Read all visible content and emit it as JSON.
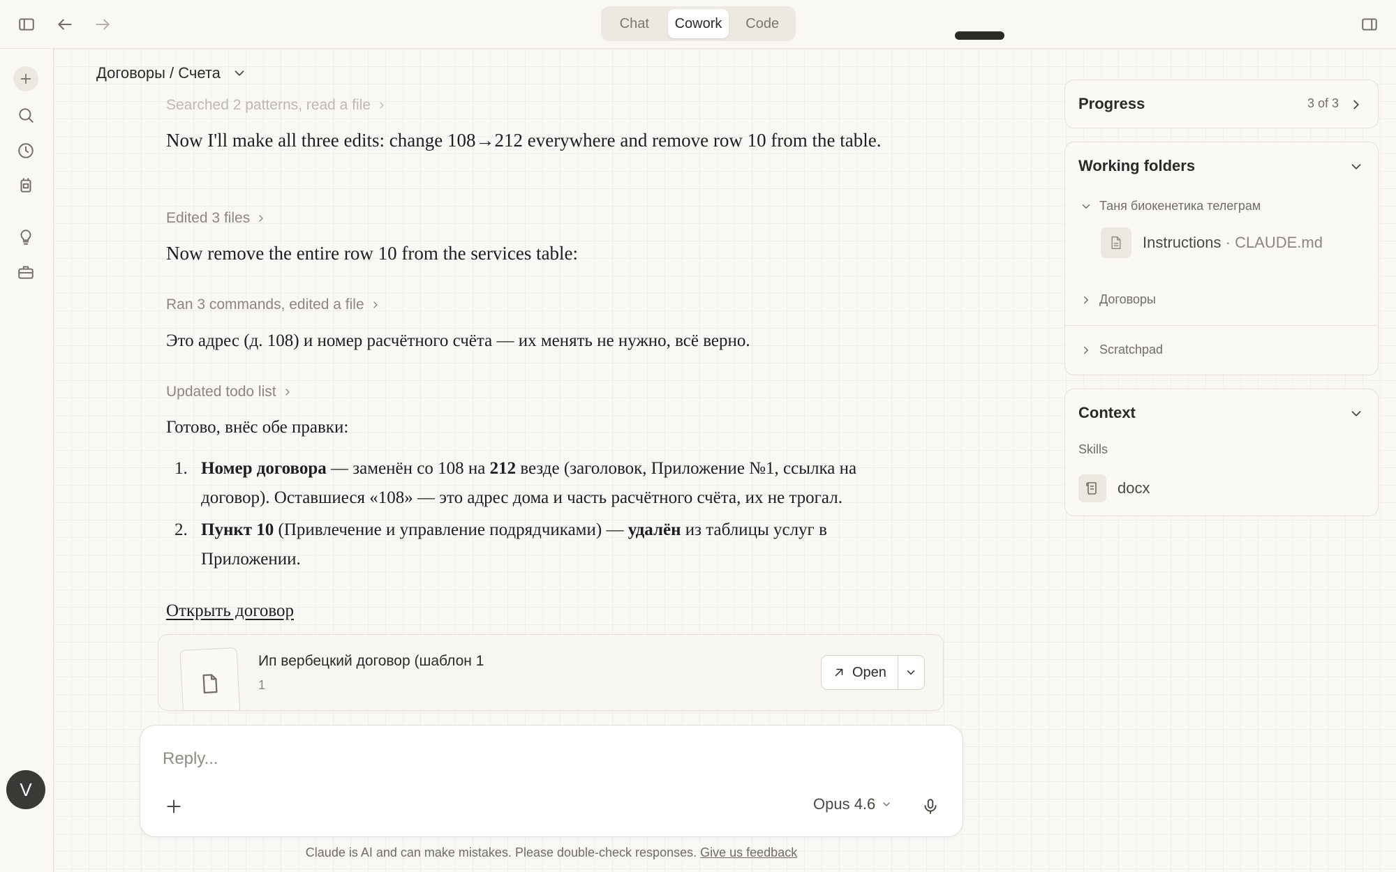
{
  "topbar": {
    "modes": [
      {
        "label": "Chat",
        "active": false
      },
      {
        "label": "Cowork",
        "active": true
      },
      {
        "label": "Code",
        "active": false
      }
    ]
  },
  "rail": {
    "icons": [
      "plus-icon",
      "search-icon",
      "clock-icon",
      "dispatch-icon",
      "lightbulb-icon",
      "toolbox-icon",
      "download-icon"
    ],
    "avatar_initial": "V"
  },
  "header": {
    "breadcrumb": "Договоры / Счета"
  },
  "conversation": {
    "step_searched": "Searched 2 patterns, read a file",
    "msg_edits_intro": "Now I'll make all three edits: change 108→212 everywhere and remove row 10 from the table.",
    "step_edited": "Edited 3 files",
    "msg_remove_row": "Now remove the entire row 10 from the services table:",
    "step_ran": "Ran 3 commands, edited a file",
    "msg_address": "Это адрес (д. 108) и номер расчётного счёта — их менять не нужно, всё верно.",
    "step_todo": "Updated todo list",
    "msg_done": "Готово, внёс обе правки:",
    "list": [
      {
        "num": "1.",
        "bold1": "Номер договора",
        "text1": " — заменён со 108 на ",
        "bold2": "212",
        "text2": " везде (заголовок, Приложение №1, ссылка на договор). Оставшиеся «108» — это адрес дома и часть расчётного счёта, их не трогал."
      },
      {
        "num": "2.",
        "bold1": "Пункт 10",
        "text1": " (Привлечение и управление подрядчиками) — ",
        "bold2": "удалён",
        "text2": " из таблицы услуг в Приложении."
      }
    ],
    "open_link": "Открыть договор",
    "file_card": {
      "name": "Ип вербецкий договор (шаблон 1",
      "sub": "1",
      "open_label": "Open"
    }
  },
  "reply": {
    "placeholder": "Reply...",
    "model": "Opus 4.6",
    "disclaimer": "Claude is AI and can make mistakes. Please double-check responses.",
    "feedback_link": "Give us feedback"
  },
  "right_panel": {
    "progress": {
      "title": "Progress",
      "count": "3 of 3"
    },
    "working_folders": {
      "title": "Working folders",
      "folders": [
        {
          "name": "Таня биокенетика телеграм",
          "expanded": true
        },
        {
          "name": "Договоры",
          "expanded": false
        },
        {
          "name": "Scratchpad",
          "expanded": false
        }
      ],
      "file": {
        "label": "Instructions",
        "separator": " · ",
        "filename": "CLAUDE.md"
      }
    },
    "context": {
      "title": "Context",
      "skills_label": "Skills",
      "skill": "docx"
    }
  },
  "colors": {
    "background": "#f9f8f5",
    "text": "#2b2a27",
    "muted": "#8a877f",
    "panel_border": "#e3e0d8"
  }
}
